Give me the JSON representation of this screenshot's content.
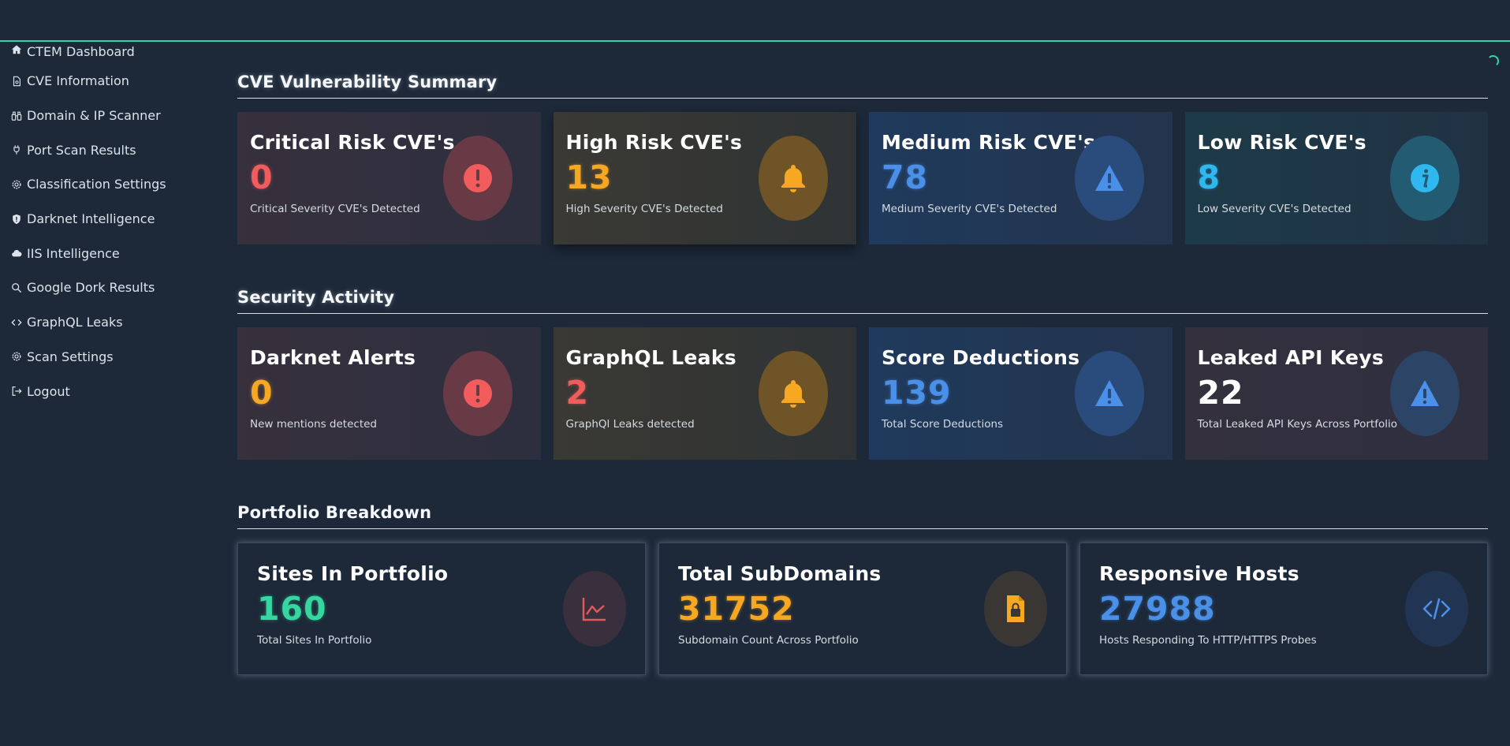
{
  "sidebar": {
    "items": [
      {
        "label": "CTEM Dashboard",
        "icon": "home-icon"
      },
      {
        "label": "CVE Information",
        "icon": "file-icon"
      },
      {
        "label": "Domain & IP Scanner",
        "icon": "binoculars-icon"
      },
      {
        "label": "Port Scan Results",
        "icon": "plug-icon"
      },
      {
        "label": "Classification Settings",
        "icon": "gear-icon"
      },
      {
        "label": "Darknet Intelligence",
        "icon": "shield-icon"
      },
      {
        "label": "IIS Intelligence",
        "icon": "cloud-icon"
      },
      {
        "label": "Google Dork Results",
        "icon": "search-icon"
      },
      {
        "label": "GraphQL Leaks",
        "icon": "code-icon"
      },
      {
        "label": "Scan Settings",
        "icon": "gear-icon"
      },
      {
        "label": "Logout",
        "icon": "logout-icon"
      }
    ]
  },
  "cve_summary": {
    "title": "CVE Vulnerability Summary",
    "cards": [
      {
        "title": "Critical Risk CVE's",
        "value": "0",
        "subtitle": "Critical Severity CVE's Detected",
        "icon": "exclamation-icon",
        "color": "#f25c5c"
      },
      {
        "title": "High Risk CVE's",
        "value": "13",
        "subtitle": "High Severity CVE's Detected",
        "icon": "bell-icon",
        "color": "#f7a823"
      },
      {
        "title": "Medium Risk CVE's",
        "value": "78",
        "subtitle": "Medium Severity CVE's Detected",
        "icon": "warning-icon",
        "color": "#4a90e8"
      },
      {
        "title": "Low Risk CVE's",
        "value": "8",
        "subtitle": "Low Severity CVE's Detected",
        "icon": "info-icon",
        "color": "#2fb8f0"
      }
    ]
  },
  "security_activity": {
    "title": "Security Activity",
    "cards": [
      {
        "title": "Darknet Alerts",
        "value": "0",
        "subtitle": "New mentions detected",
        "icon": "exclamation-icon",
        "color": "#f7a823"
      },
      {
        "title": "GraphQL Leaks",
        "value": "2",
        "subtitle": "GraphQl Leaks detected",
        "icon": "bell-icon",
        "color": "#f25c5c"
      },
      {
        "title": "Score Deductions",
        "value": "139",
        "subtitle": "Total Score Deductions",
        "icon": "warning-icon",
        "color": "#4a90e8"
      },
      {
        "title": "Leaked API Keys",
        "value": "22",
        "subtitle": "Total Leaked API Keys Across Portfolio",
        "icon": "warning-icon",
        "color": "#ffffff"
      }
    ]
  },
  "portfolio": {
    "title": "Portfolio Breakdown",
    "cards": [
      {
        "title": "Sites In Portfolio",
        "value": "160",
        "subtitle": "Total Sites In Portfolio",
        "icon": "chart-icon",
        "color": "#35d6a0"
      },
      {
        "title": "Total SubDomains",
        "value": "31752",
        "subtitle": "Subdomain Count Across Portfolio",
        "icon": "lock-file-icon",
        "color": "#f7a823"
      },
      {
        "title": "Responsive Hosts",
        "value": "27988",
        "subtitle": "Hosts Responding To HTTP/HTTPS Probes",
        "icon": "code-icon",
        "color": "#4a90e8"
      }
    ]
  },
  "accent_color": "#2fd7a6"
}
